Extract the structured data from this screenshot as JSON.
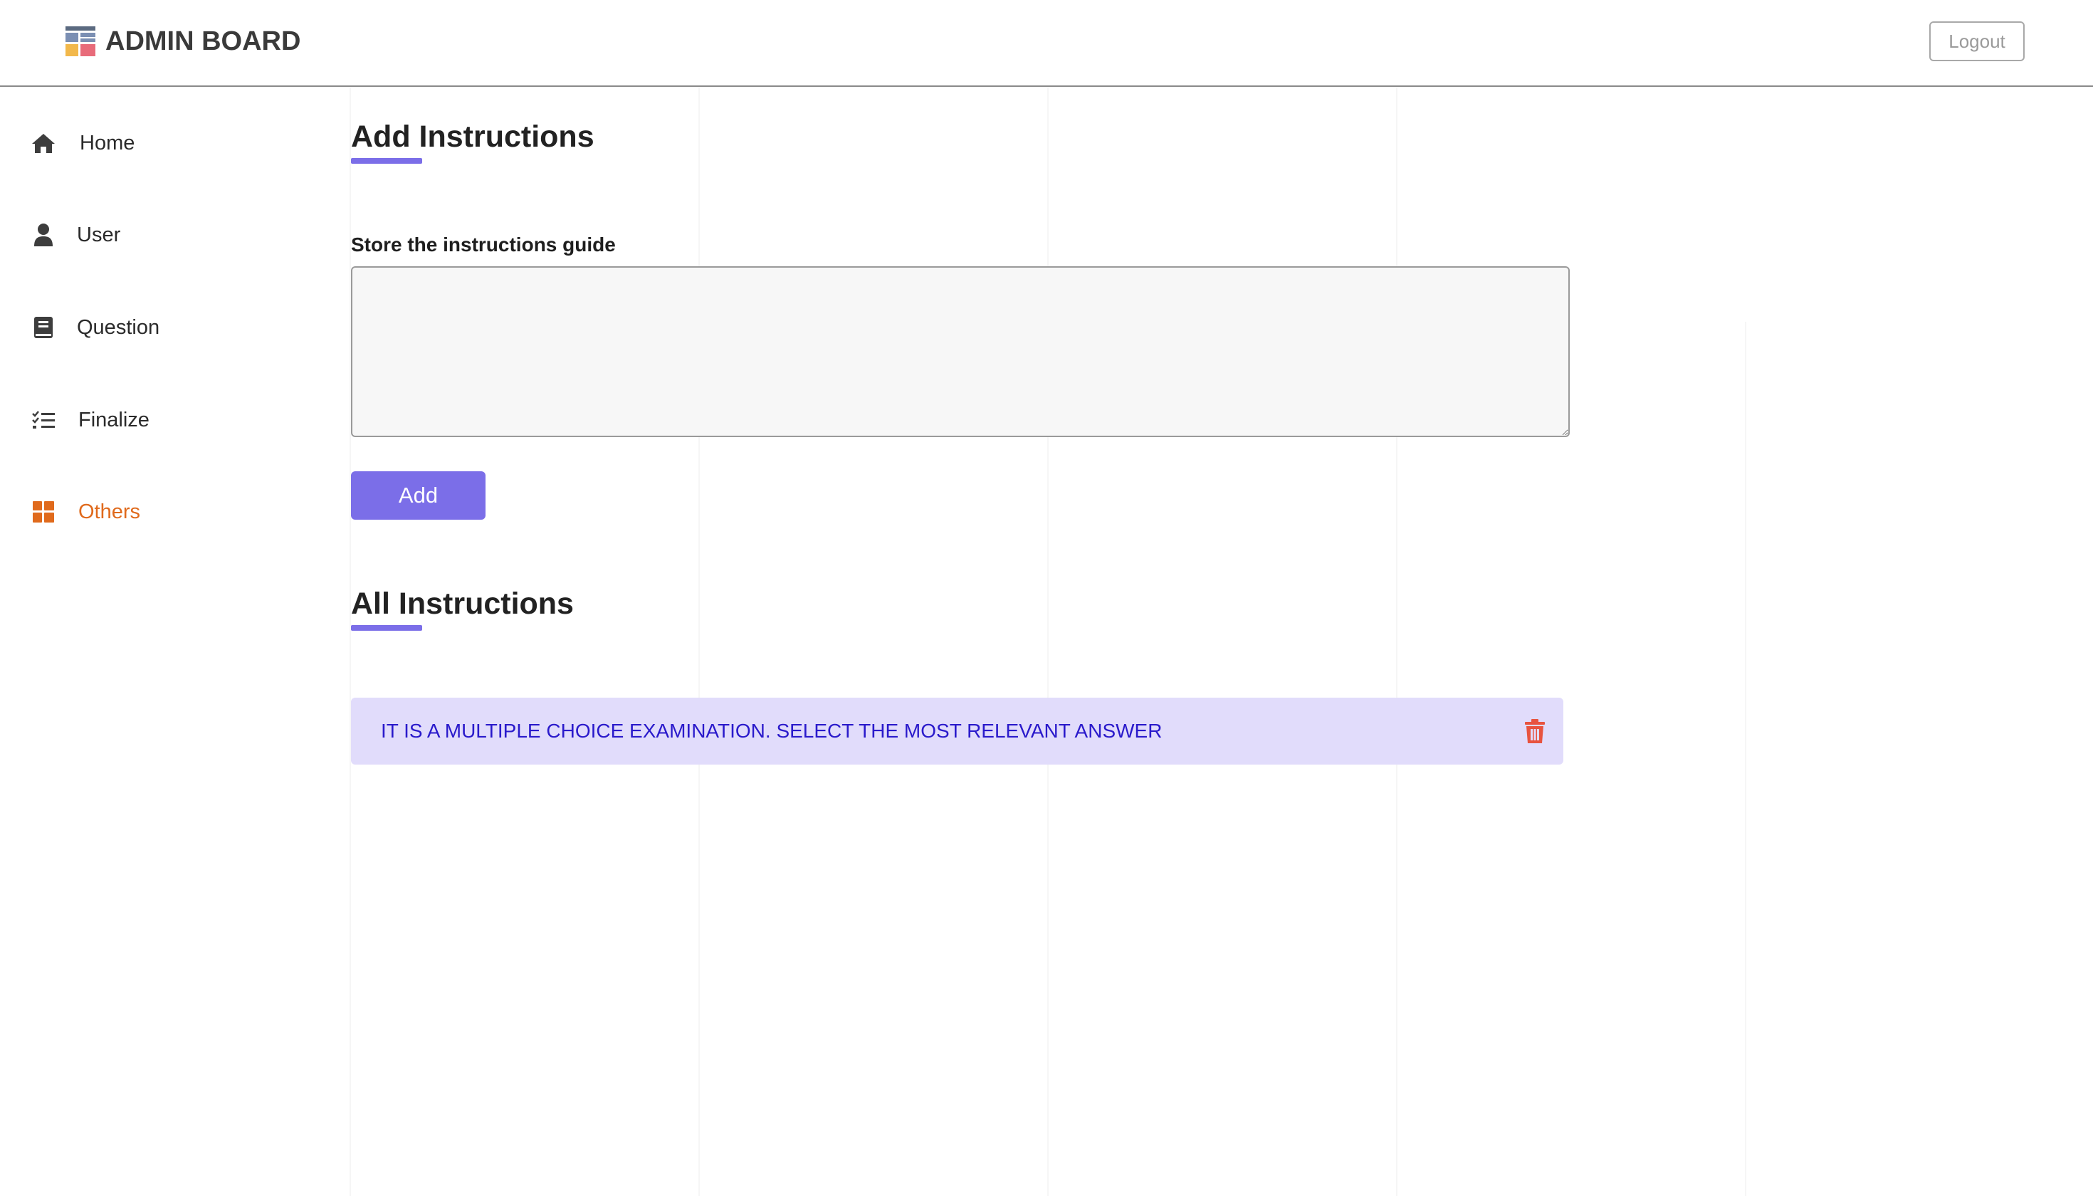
{
  "header": {
    "brand_title": "ADMIN BOARD",
    "brand_icon": "dashboard-icon",
    "logout_label": "Logout"
  },
  "sidebar": {
    "items": [
      {
        "label": "Home",
        "icon": "home-icon",
        "active": false
      },
      {
        "label": "User",
        "icon": "user-icon",
        "active": false
      },
      {
        "label": "Question",
        "icon": "book-icon",
        "active": false
      },
      {
        "label": "Finalize",
        "icon": "list-check-icon",
        "active": false
      },
      {
        "label": "Others",
        "icon": "grid-icon",
        "active": true
      }
    ]
  },
  "main": {
    "add_section_title": "Add Instructions",
    "field_label": "Store the instructions guide",
    "input_value": "",
    "add_button_label": "Add",
    "all_section_title": "All Instructions",
    "instructions": [
      {
        "text": "IT IS A MULTIPLE CHOICE EXAMINATION. SELECT THE MOST RELEVANT ANSWER",
        "delete_icon": "trash-icon"
      }
    ]
  },
  "colors": {
    "accent": "#7b6ee8",
    "active_nav": "#e06a1c",
    "item_bg": "#e1dcfb",
    "item_text": "#2a1acb",
    "delete": "#e8533f"
  }
}
